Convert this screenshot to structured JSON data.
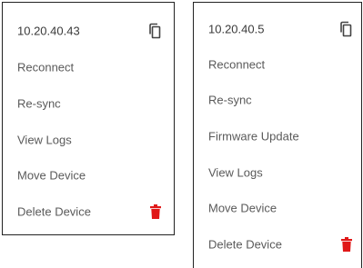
{
  "colors": {
    "text": "#5a5a5a",
    "border": "#222222",
    "delete_icon": "#e01818",
    "copy_icon": "#444444"
  },
  "menu_left": {
    "header": {
      "ip": "10.20.40.43",
      "icon": "copy-icon"
    },
    "items": [
      {
        "label": "Reconnect"
      },
      {
        "label": "Re-sync"
      },
      {
        "label": "View Logs"
      },
      {
        "label": "Move Device"
      },
      {
        "label": "Delete Device",
        "icon": "trash-icon"
      }
    ]
  },
  "menu_right": {
    "header": {
      "ip": "10.20.40.5",
      "icon": "copy-icon"
    },
    "items": [
      {
        "label": "Reconnect"
      },
      {
        "label": "Re-sync"
      },
      {
        "label": "Firmware Update"
      },
      {
        "label": "View Logs"
      },
      {
        "label": "Move Device"
      },
      {
        "label": "Delete Device",
        "icon": "trash-icon"
      }
    ]
  }
}
